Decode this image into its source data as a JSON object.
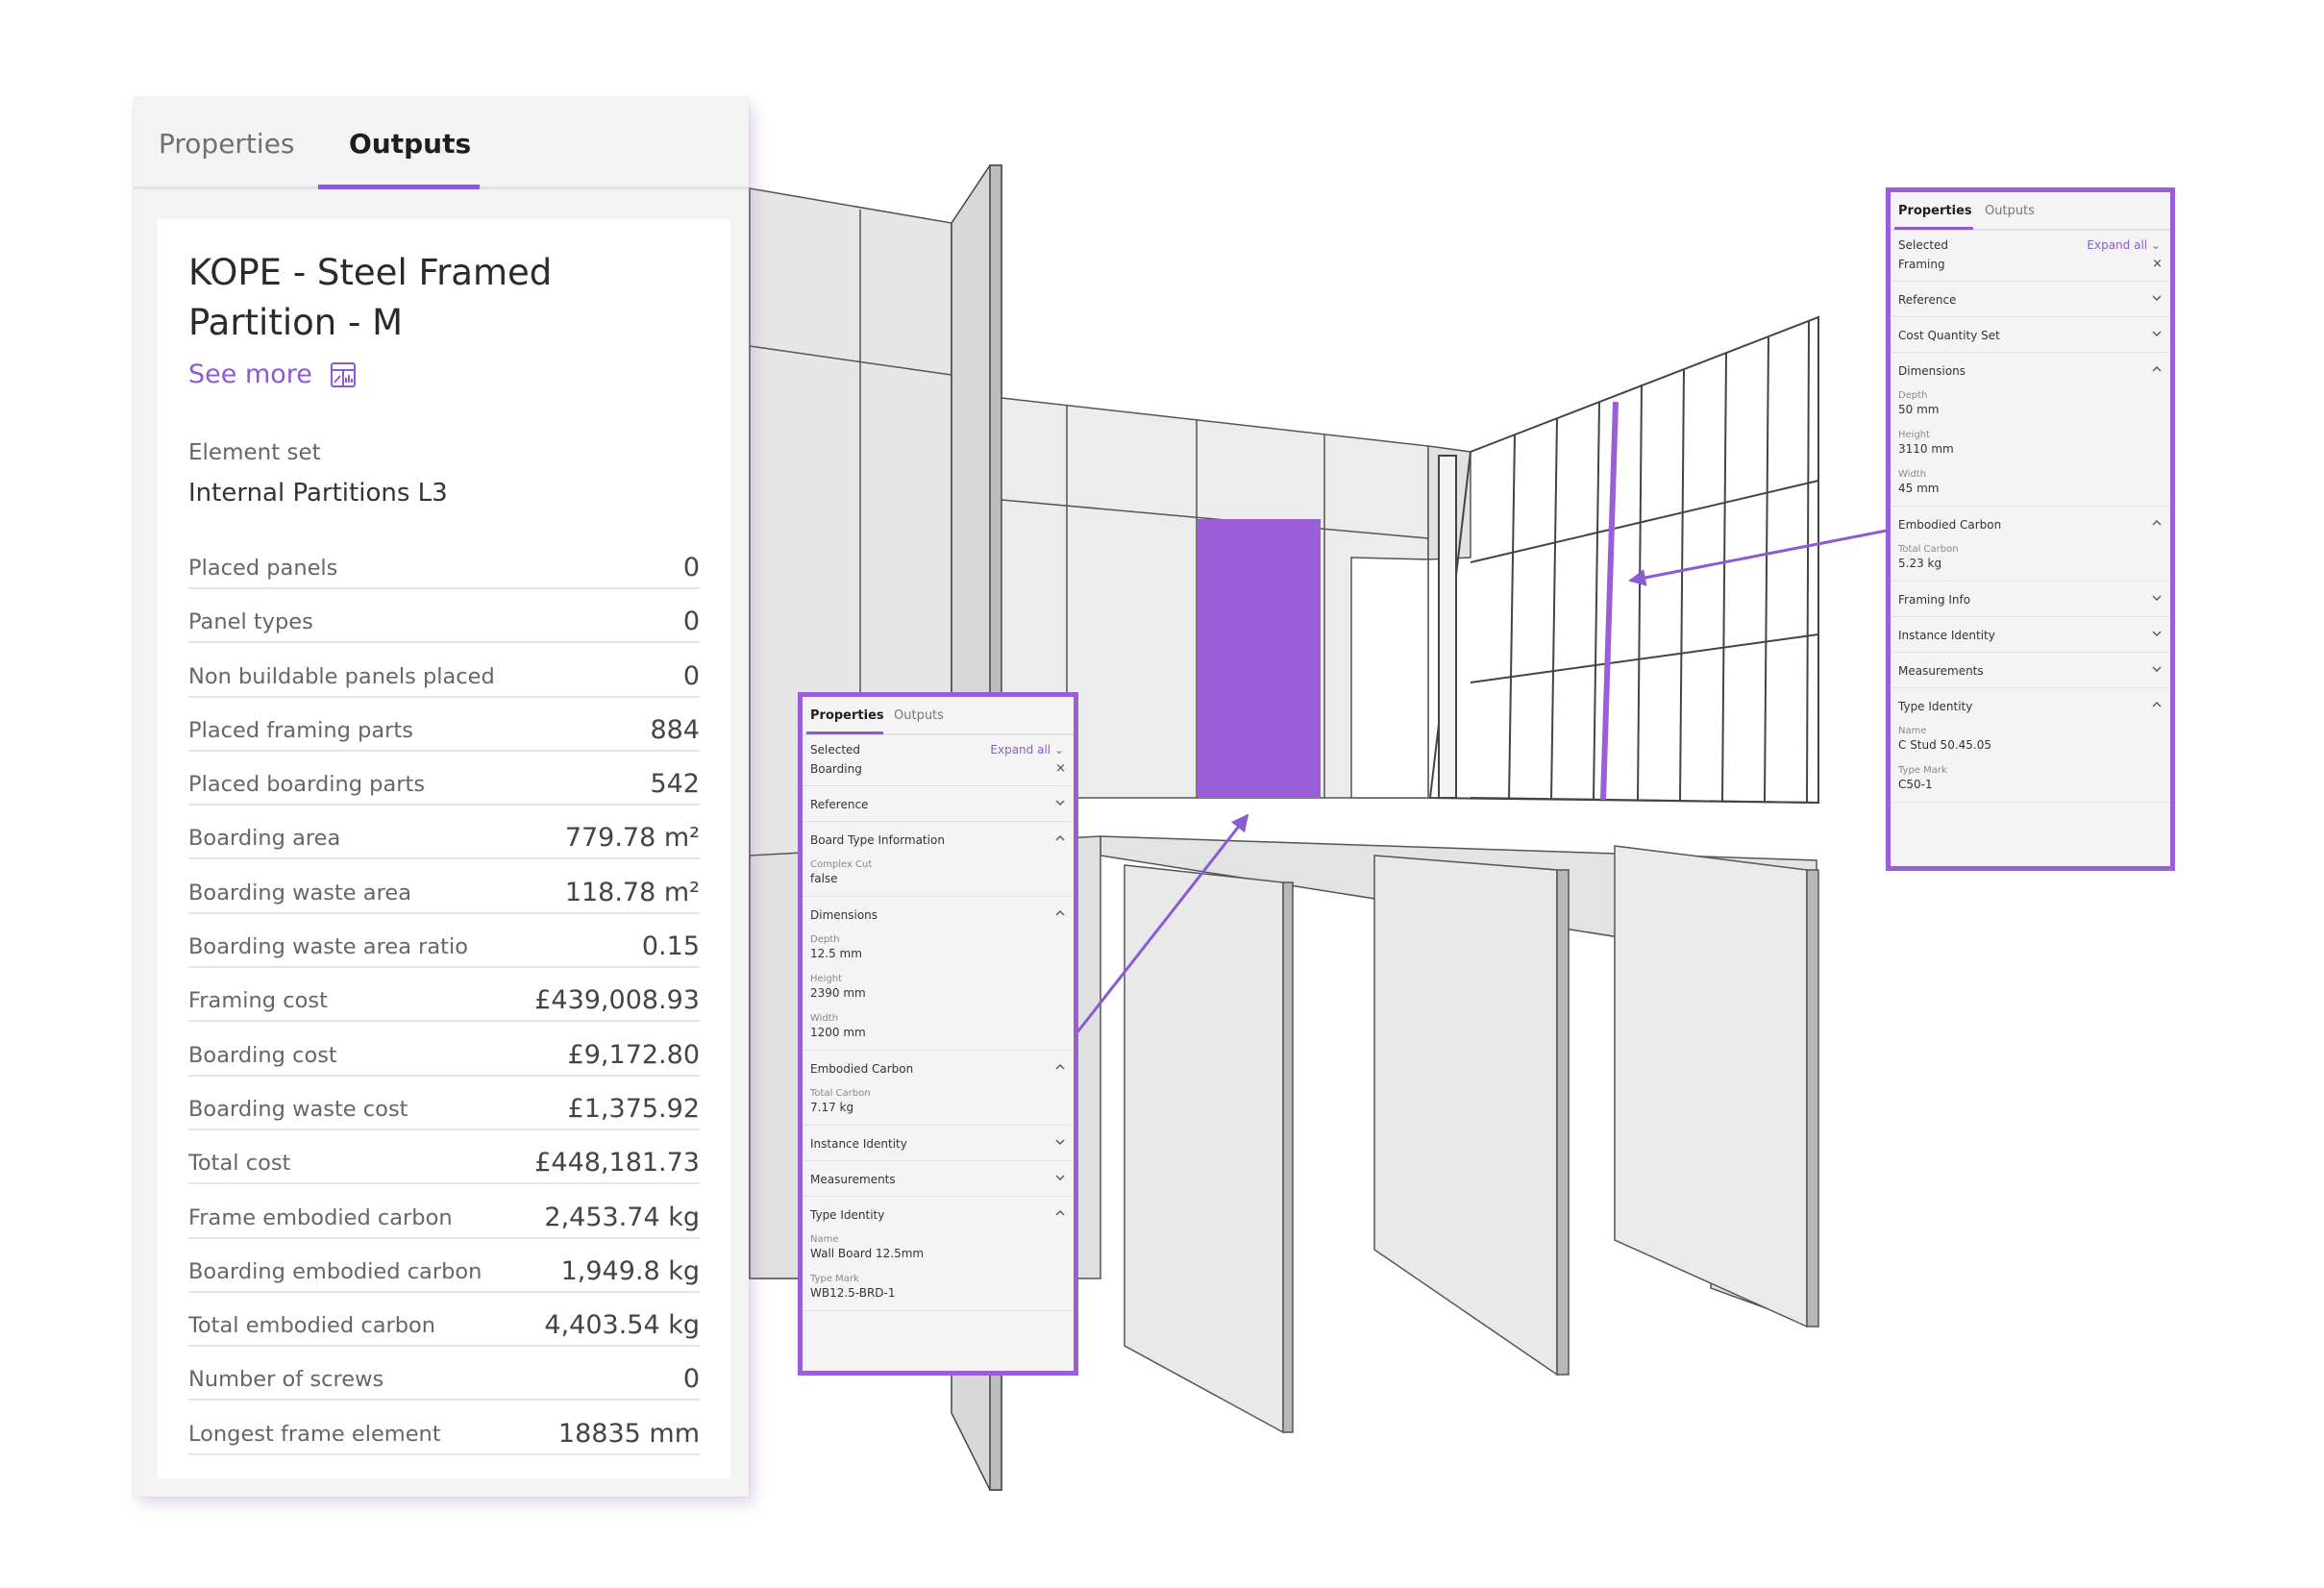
{
  "colors": {
    "accent": "#8c5ad2",
    "highlight": "#9a5fd8"
  },
  "outputs_panel": {
    "tabs": [
      "Properties",
      "Outputs"
    ],
    "active_tab": "Outputs",
    "title": "KOPE - Steel Framed Partition - M",
    "see_more": "See more",
    "element_set_label": "Element set",
    "element_set_value": "Internal Partitions L3",
    "rows": [
      {
        "label": "Placed panels",
        "value": "0"
      },
      {
        "label": "Panel types",
        "value": "0"
      },
      {
        "label": "Non buildable panels placed",
        "value": "0"
      },
      {
        "label": "Placed framing parts",
        "value": "884"
      },
      {
        "label": "Placed boarding parts",
        "value": "542"
      },
      {
        "label": "Boarding area",
        "value": "779.78 m²"
      },
      {
        "label": "Boarding waste area",
        "value": "118.78 m²"
      },
      {
        "label": "Boarding waste area ratio",
        "value": "0.15"
      },
      {
        "label": "Framing cost",
        "value": "£439,008.93"
      },
      {
        "label": "Boarding cost",
        "value": "£9,172.80"
      },
      {
        "label": "Boarding waste cost",
        "value": "£1,375.92"
      },
      {
        "label": "Total cost",
        "value": "£448,181.73"
      },
      {
        "label": "Frame embodied carbon",
        "value": "2,453.74 kg"
      },
      {
        "label": "Boarding embodied carbon",
        "value": "1,949.8 kg"
      },
      {
        "label": "Total embodied carbon",
        "value": "4,403.54 kg"
      },
      {
        "label": "Number of screws",
        "value": "0"
      },
      {
        "label": "Longest frame element",
        "value": "18835 mm"
      }
    ]
  },
  "boarding_panel": {
    "tabs": [
      "Properties",
      "Outputs"
    ],
    "selected": "Selected",
    "expand_all": "Expand all",
    "chip": "Boarding",
    "sections": [
      {
        "title": "Reference",
        "open": false,
        "fields": []
      },
      {
        "title": "Board Type Information",
        "open": true,
        "fields": [
          {
            "label": "Complex Cut",
            "value": "false"
          }
        ]
      },
      {
        "title": "Dimensions",
        "open": true,
        "fields": [
          {
            "label": "Depth",
            "value": "12.5 mm"
          },
          {
            "label": "Height",
            "value": "2390 mm"
          },
          {
            "label": "Width",
            "value": "1200 mm"
          }
        ]
      },
      {
        "title": "Embodied Carbon",
        "open": true,
        "fields": [
          {
            "label": "Total Carbon",
            "value": "7.17 kg"
          }
        ]
      },
      {
        "title": "Instance Identity",
        "open": false,
        "fields": []
      },
      {
        "title": "Measurements",
        "open": false,
        "fields": []
      },
      {
        "title": "Type Identity",
        "open": true,
        "fields": [
          {
            "label": "Name",
            "value": "Wall Board 12.5mm"
          },
          {
            "label": "Type Mark",
            "value": "WB12.5-BRD-1"
          }
        ]
      }
    ]
  },
  "framing_panel": {
    "tabs": [
      "Properties",
      "Outputs"
    ],
    "selected": "Selected",
    "expand_all": "Expand all",
    "chip": "Framing",
    "sections": [
      {
        "title": "Reference",
        "open": false,
        "fields": []
      },
      {
        "title": "Cost Quantity Set",
        "open": false,
        "fields": []
      },
      {
        "title": "Dimensions",
        "open": true,
        "fields": [
          {
            "label": "Depth",
            "value": "50 mm"
          },
          {
            "label": "Height",
            "value": "3110 mm"
          },
          {
            "label": "Width",
            "value": "45 mm"
          }
        ]
      },
      {
        "title": "Embodied Carbon",
        "open": true,
        "fields": [
          {
            "label": "Total Carbon",
            "value": "5.23 kg"
          }
        ]
      },
      {
        "title": "Framing Info",
        "open": false,
        "fields": []
      },
      {
        "title": "Instance Identity",
        "open": false,
        "fields": []
      },
      {
        "title": "Measurements",
        "open": false,
        "fields": []
      },
      {
        "title": "Type Identity",
        "open": true,
        "fields": [
          {
            "label": "Name",
            "value": "C Stud 50.45.05"
          },
          {
            "label": "Type Mark",
            "value": "C50-1"
          }
        ]
      }
    ]
  }
}
